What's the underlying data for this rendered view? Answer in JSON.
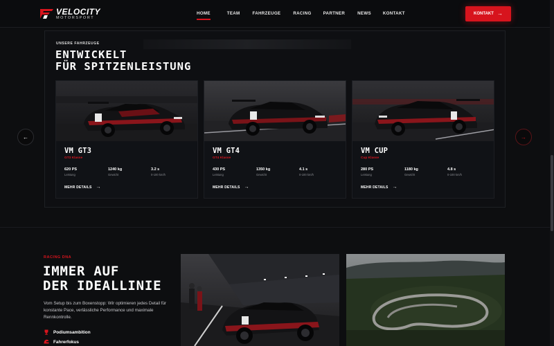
{
  "nav": {
    "logo_main": "VELOCITY",
    "logo_sub": "MOTORSPORT",
    "items": [
      {
        "label": "HOME",
        "active": true
      },
      {
        "label": "TEAM",
        "active": false
      },
      {
        "label": "FAHRZEUGE",
        "active": false
      },
      {
        "label": "RACING",
        "active": false
      },
      {
        "label": "PARTNER",
        "active": false
      },
      {
        "label": "NEWS",
        "active": false
      },
      {
        "label": "KONTAKT",
        "active": false
      }
    ],
    "cta_label": "KONTAKT",
    "cta_icon": "arrow-right-icon"
  },
  "vehicles": {
    "eyebrow": "UNSERE FAHRZEUGE",
    "title_line1": "ENTWICKELT",
    "title_line2": "FÜR SPITZENLEISTUNG",
    "cards": [
      {
        "name": "VM GT3",
        "class": "GT3 Klasse",
        "specs": [
          {
            "value": "620 PS",
            "label": "Leistung"
          },
          {
            "value": "1240 kg",
            "label": "Gewicht"
          },
          {
            "value": "3.2 s",
            "label": "0-100 km/h"
          }
        ],
        "link": "MEHR DETAILS"
      },
      {
        "name": "VM GT4",
        "class": "GT4 Klasse",
        "specs": [
          {
            "value": "430 PS",
            "label": "Leistung"
          },
          {
            "value": "1350 kg",
            "label": "Gewicht"
          },
          {
            "value": "4.1 s",
            "label": "0-100 km/h"
          }
        ],
        "link": "MEHR DETAILS"
      },
      {
        "name": "VM CUP",
        "class": "Cup Klasse",
        "specs": [
          {
            "value": "280 PS",
            "label": "Leistung"
          },
          {
            "value": "1180 kg",
            "label": "Gewicht"
          },
          {
            "value": "4.8 s",
            "label": "0-100 km/h"
          }
        ],
        "link": "MEHR DETAILS"
      }
    ],
    "prev_icon": "arrow-left-icon",
    "next_icon": "arrow-right-icon"
  },
  "dna": {
    "eyebrow": "RACING DNA",
    "title_line1": "IMMER AUF",
    "title_line2": "DER IDEALLINIE",
    "text": "Vom Setup bis zum Boxenstopp: Wir optimieren jedes Detail für konstante Pace, verlässliche Performance und maximale Rennkontrolle.",
    "features": [
      {
        "label": "Podiumsambition",
        "icon": "trophy-icon"
      },
      {
        "label": "Fahrerfokus",
        "icon": "helmet-icon"
      }
    ]
  },
  "colors": {
    "accent": "#d7141d",
    "background": "#0d0e10",
    "card": "#101216"
  }
}
